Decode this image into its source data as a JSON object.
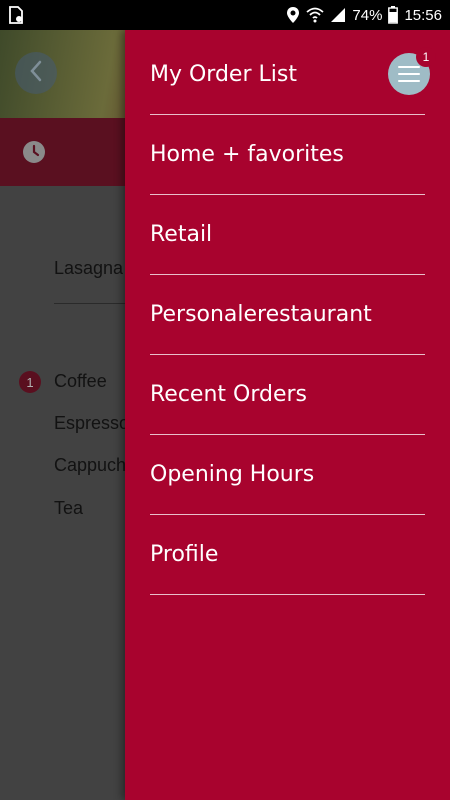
{
  "statusbar": {
    "battery": "74%",
    "time": "15:56"
  },
  "background": {
    "items": [
      "Lasagna",
      "Coffee",
      "Espresso",
      "Cappuch",
      "Tea"
    ],
    "coffee_badge": "1"
  },
  "drawer": {
    "cart_badge": "1",
    "items": [
      {
        "label": "My Order List"
      },
      {
        "label": "Home + favorites"
      },
      {
        "label": "Retail"
      },
      {
        "label": "Personalerestaurant"
      },
      {
        "label": "Recent Orders"
      },
      {
        "label": "Opening Hours"
      },
      {
        "label": "Profile"
      }
    ]
  },
  "colors": {
    "drawer_bg": "#a8032e",
    "hamburger_bg": "#9fbcc6"
  }
}
